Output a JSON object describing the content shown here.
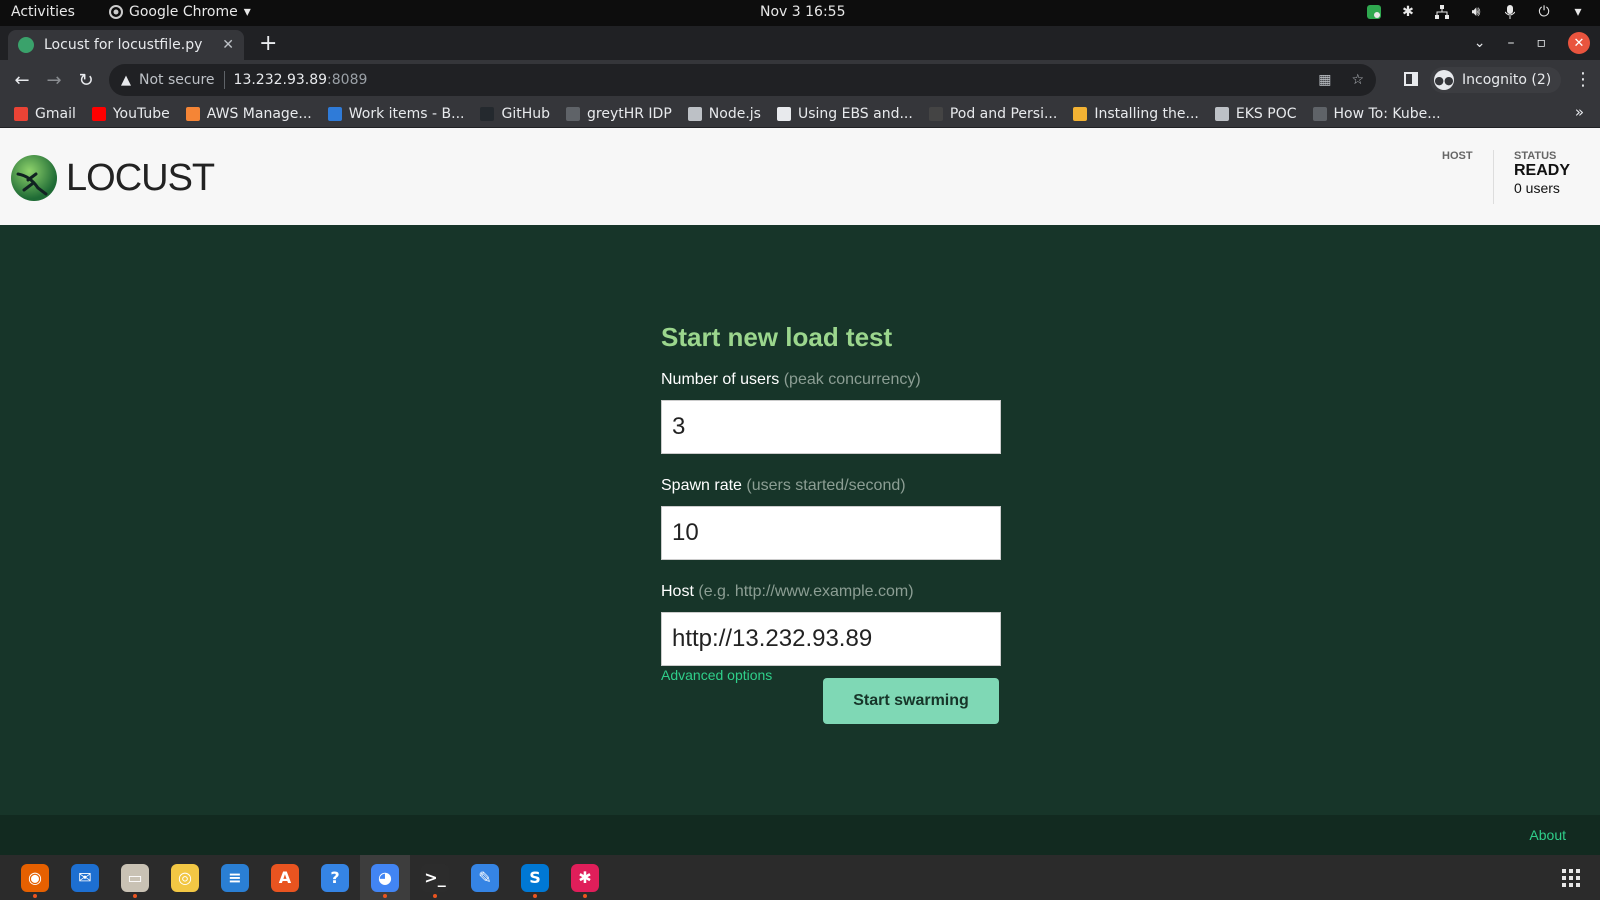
{
  "system_bar": {
    "activities": "Activities",
    "app_name": "Google Chrome",
    "clock": "Nov 3  16:55"
  },
  "browser": {
    "tab_title": "Locust for locustfile.py",
    "security_label": "Not secure",
    "url_host": "13.232.93.89",
    "url_port": ":8089",
    "profile_label": "Incognito (2)",
    "bookmarks": [
      {
        "label": "Gmail",
        "color": "#ea4335"
      },
      {
        "label": "YouTube",
        "color": "#ff0000"
      },
      {
        "label": "AWS Manage...",
        "color": "#f58536"
      },
      {
        "label": "Work items - B...",
        "color": "#2f7bd8"
      },
      {
        "label": "GitHub",
        "color": "#24292e"
      },
      {
        "label": "greytHR IDP",
        "color": "#5f6368"
      },
      {
        "label": "Node.js",
        "color": "#bdc1c6"
      },
      {
        "label": "Using EBS and...",
        "color": "#e8eaed"
      },
      {
        "label": "Pod and Persi...",
        "color": "#444"
      },
      {
        "label": "Installing the...",
        "color": "#f2b233"
      },
      {
        "label": "EKS POC",
        "color": "#bdc1c6"
      },
      {
        "label": "How To: Kube...",
        "color": "#5f6368"
      }
    ]
  },
  "locust": {
    "logo_text": "LOCUST",
    "host_label": "HOST",
    "status_label": "STATUS",
    "status_value": "READY",
    "users_value": "0 users",
    "form": {
      "title": "Start new load test",
      "users_label": "Number of users",
      "users_hint": "(peak concurrency)",
      "users_value": "3",
      "spawn_label": "Spawn rate",
      "spawn_hint": "(users started/second)",
      "spawn_value": "10",
      "host_label": "Host",
      "host_hint": "(e.g. http://www.example.com)",
      "host_value": "http://13.232.93.89",
      "advanced_label": "Advanced options",
      "submit_label": "Start swarming"
    },
    "footer_about": "About"
  },
  "dock": {
    "apps": [
      {
        "name": "firefox",
        "color": "#e66000",
        "running": true
      },
      {
        "name": "thunderbird",
        "color": "#1d6fd1",
        "running": false
      },
      {
        "name": "files",
        "color": "#c9c2b4",
        "running": true
      },
      {
        "name": "rhythmbox",
        "color": "#f2c744",
        "running": false
      },
      {
        "name": "libreoffice-writer",
        "color": "#2a7fd4",
        "running": false
      },
      {
        "name": "software-center",
        "color": "#e95420",
        "running": false
      },
      {
        "name": "help",
        "color": "#3584e4",
        "running": false
      },
      {
        "name": "chrome",
        "color": "#4285f4",
        "running": true
      },
      {
        "name": "terminal",
        "color": "#2c2c2c",
        "running": true
      },
      {
        "name": "text-editor",
        "color": "#3584e4",
        "running": false
      },
      {
        "name": "skype",
        "color": "#0078d4",
        "running": true
      },
      {
        "name": "slack",
        "color": "#e01e5a",
        "running": true
      }
    ]
  }
}
